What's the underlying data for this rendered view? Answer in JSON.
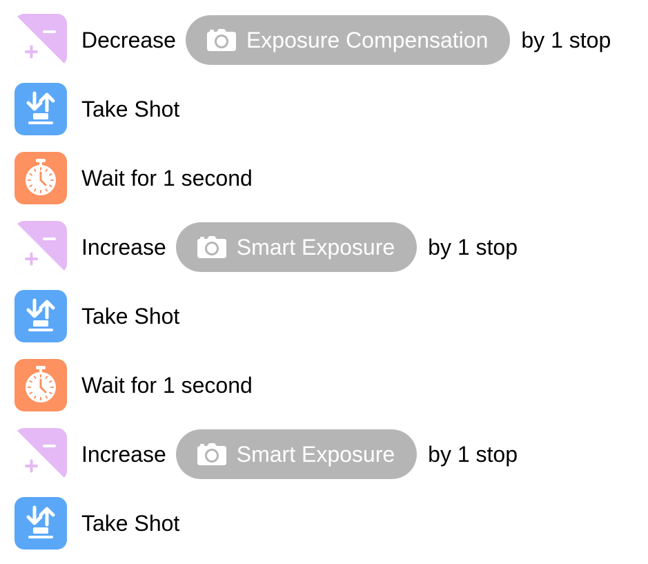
{
  "steps": [
    {
      "kind": "exposure",
      "icon": "exposure-compensation-icon",
      "action": "Decrease",
      "parameter": "Exposure Compensation",
      "suffix": "by 1 stop"
    },
    {
      "kind": "shot",
      "icon": "take-shot-icon",
      "action": "Take Shot"
    },
    {
      "kind": "wait",
      "icon": "stopwatch-icon",
      "action": "Wait for 1 second"
    },
    {
      "kind": "exposure",
      "icon": "exposure-compensation-icon",
      "action": "Increase",
      "parameter": "Smart Exposure",
      "suffix": "by 1 stop"
    },
    {
      "kind": "shot",
      "icon": "take-shot-icon",
      "action": "Take Shot"
    },
    {
      "kind": "wait",
      "icon": "stopwatch-icon",
      "action": "Wait for 1 second"
    },
    {
      "kind": "exposure",
      "icon": "exposure-compensation-icon",
      "action": "Increase",
      "parameter": "Smart Exposure",
      "suffix": "by 1 stop"
    },
    {
      "kind": "shot",
      "icon": "take-shot-icon",
      "action": "Take Shot"
    }
  ],
  "colors": {
    "exposure_tile": "#e4b9f5",
    "shot_tile": "#5aa7f8",
    "wait_tile": "#fd9160",
    "parameter_pill": "#b5b5b5"
  }
}
